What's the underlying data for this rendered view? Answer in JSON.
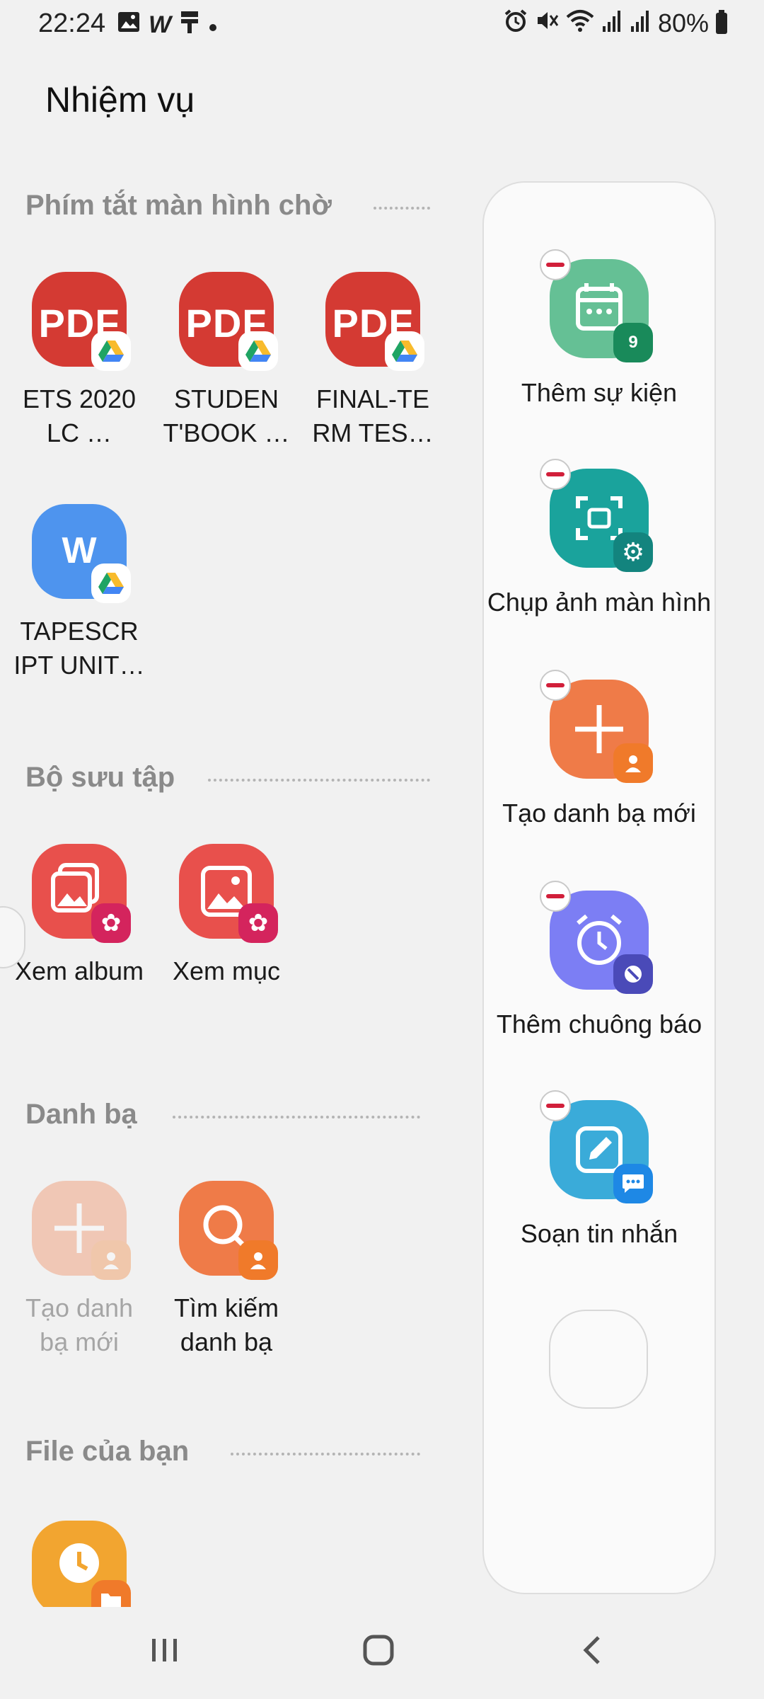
{
  "status_bar": {
    "time": "22:24",
    "battery": "80%",
    "notification_icons": [
      "image-icon",
      "w-icon",
      "tool-icon",
      "dot-icon"
    ],
    "system_icons": [
      "alarm-icon",
      "mute-icon",
      "wifi-icon",
      "signal-icon",
      "signal-icon",
      "battery-icon"
    ]
  },
  "page": {
    "title": "Nhiệm vụ"
  },
  "sections": {
    "home_shortcuts": {
      "title": "Phím tắt màn hình chờ",
      "items": [
        {
          "label": "ETS 2020 LC …",
          "icon_text": "PDF",
          "icon": "pdf-icon",
          "badge": "google-drive-icon"
        },
        {
          "label": "STUDEN T'BOOK …",
          "icon_text": "PDF",
          "icon": "pdf-icon",
          "badge": "google-drive-icon"
        },
        {
          "label": "FINAL-TE RM TES…",
          "icon_text": "PDF",
          "icon": "pdf-icon",
          "badge": "google-drive-icon"
        },
        {
          "label": "TAPESCR IPT UNIT…",
          "icon_text": "W",
          "icon": "word-icon",
          "badge": "google-drive-icon"
        }
      ]
    },
    "gallery": {
      "title": "Bộ sưu tập",
      "items": [
        {
          "label": "Xem album",
          "icon": "gallery-icon"
        },
        {
          "label": "Xem mục",
          "icon": "gallery-icon"
        }
      ]
    },
    "contacts": {
      "title": "Danh bạ",
      "items": [
        {
          "label": "Tạo danh bạ mới",
          "icon": "add-contact-icon",
          "disabled": true
        },
        {
          "label": "Tìm kiếm danh bạ",
          "icon": "search-contact-icon"
        }
      ]
    },
    "files": {
      "title": "File của bạn",
      "items": [
        {
          "label": "",
          "icon": "recent-files-icon"
        }
      ]
    }
  },
  "panel": {
    "items": [
      {
        "label": "Thêm sự kiện",
        "icon": "calendar-icon",
        "badge_text": "9"
      },
      {
        "label": "Chụp ảnh màn hình",
        "icon": "screenshot-icon"
      },
      {
        "label": "Tạo danh bạ mới",
        "icon": "add-contact-icon"
      },
      {
        "label": "Thêm chuông báo",
        "icon": "alarm-icon"
      },
      {
        "label": "Soạn tin nhắn",
        "icon": "message-icon"
      }
    ]
  },
  "colors": {
    "pdf": "#d43a33",
    "word": "#4e94ee",
    "gallery": "#e8504c",
    "contact": "#ef7b48",
    "calendar": "#65c095",
    "screenshot": "#1aa39c",
    "alarm": "#7c7ef4",
    "message": "#3aabd9",
    "remove": "#d11f3a"
  }
}
